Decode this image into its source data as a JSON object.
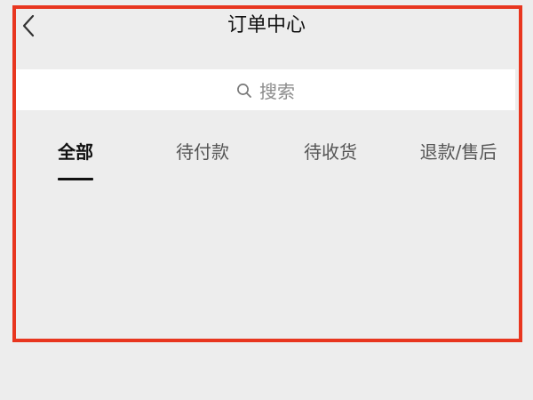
{
  "header": {
    "title": "订单中心",
    "back_icon": "chevron-left-icon"
  },
  "search": {
    "placeholder": "搜索",
    "icon": "search-icon"
  },
  "tabs": [
    {
      "label": "全部",
      "active": true
    },
    {
      "label": "待付款",
      "active": false
    },
    {
      "label": "待收货",
      "active": false
    },
    {
      "label": "退款/售后",
      "active": false
    }
  ],
  "colors": {
    "background": "#ededed",
    "surface": "#ffffff",
    "highlight_border": "#e8361f",
    "text_primary": "#111111",
    "text_secondary": "#555555",
    "placeholder": "#8c8c8c"
  }
}
